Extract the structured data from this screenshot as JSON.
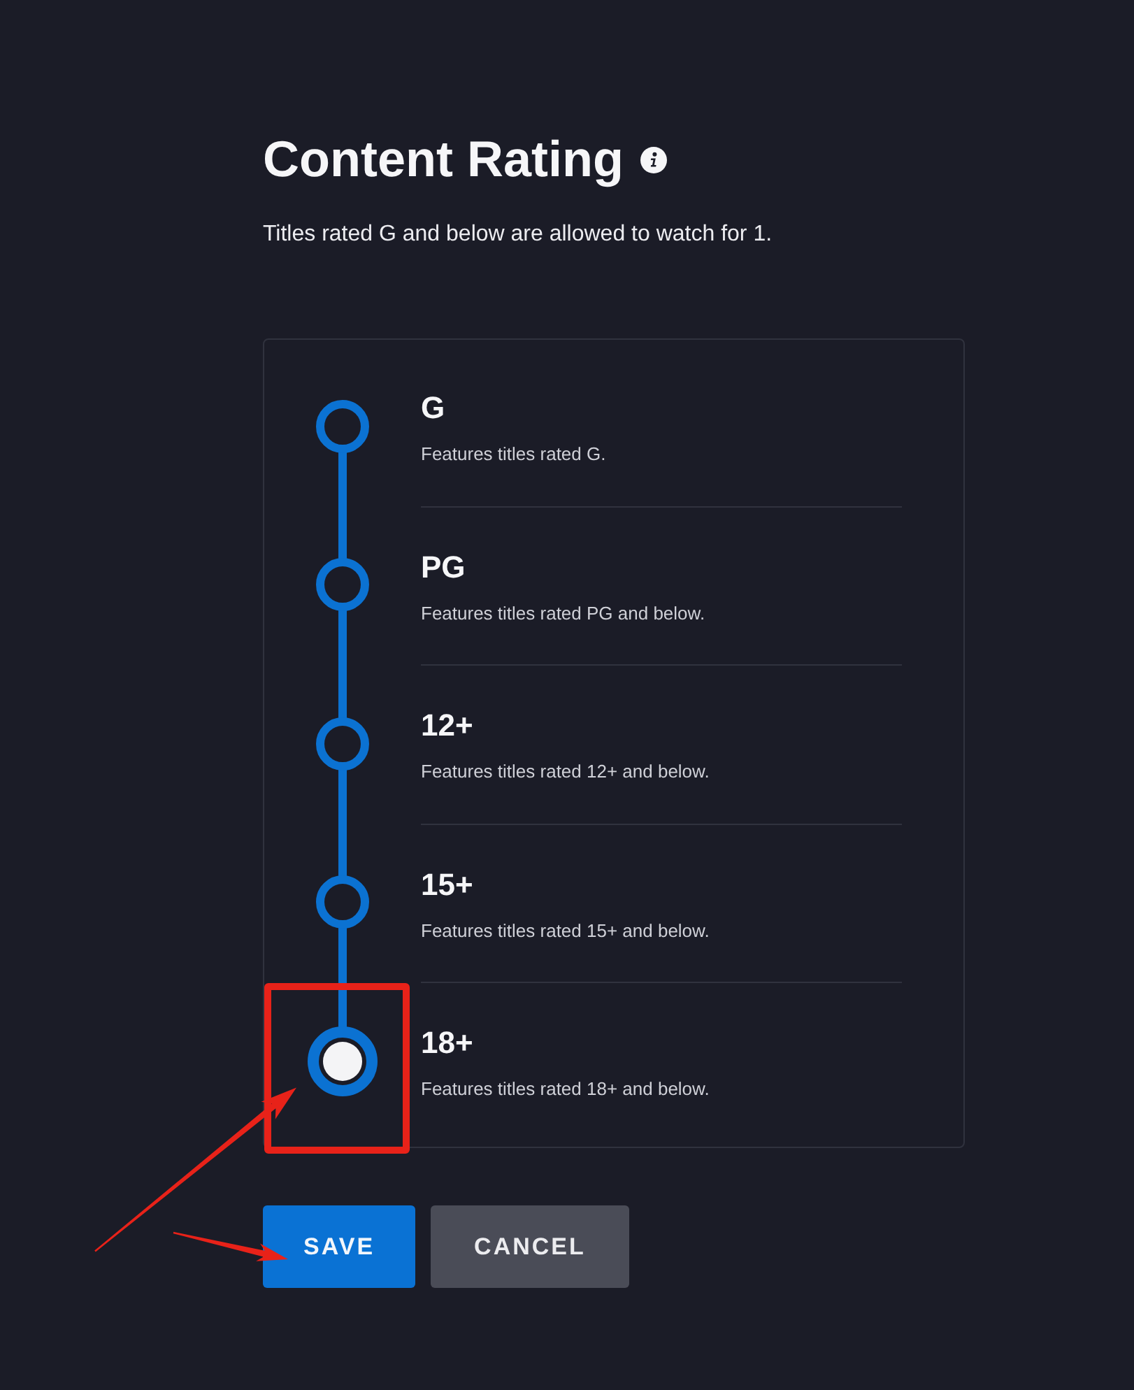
{
  "header": {
    "title": "Content Rating",
    "description": "Titles rated G and below are allowed to watch for 1."
  },
  "ratings": [
    {
      "label": "G",
      "description": "Features titles rated G.",
      "selected": false
    },
    {
      "label": "PG",
      "description": "Features titles rated PG and below.",
      "selected": false
    },
    {
      "label": "12+",
      "description": "Features titles rated 12+ and below.",
      "selected": false
    },
    {
      "label": "15+",
      "description": "Features titles rated 15+ and below.",
      "selected": false
    },
    {
      "label": "18+",
      "description": "Features titles rated 18+ and below.",
      "selected": true
    }
  ],
  "buttons": [
    {
      "kind": "primary",
      "label": "SAVE"
    },
    {
      "kind": "secondary",
      "label": "CANCEL"
    }
  ],
  "annotations": [
    {
      "kind": "box"
    },
    {
      "kind": "arrow"
    },
    {
      "kind": "arrow"
    }
  ]
}
